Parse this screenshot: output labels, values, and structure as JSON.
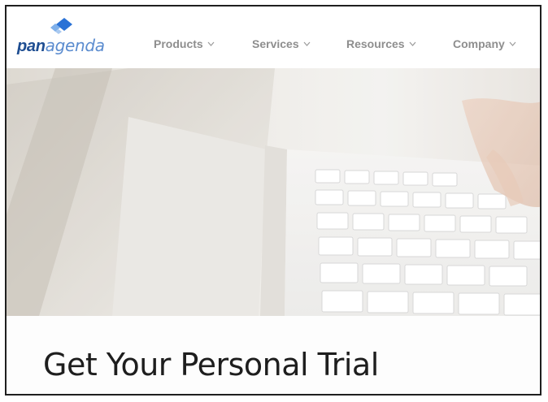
{
  "brand": {
    "logo_part1": "pan",
    "logo_part2": "agenda",
    "primary_color": "#1f4e92",
    "accent_color": "#5b8ccf"
  },
  "nav": {
    "items": [
      {
        "label": "Products",
        "icon": "chevron-down-icon"
      },
      {
        "label": "Services",
        "icon": "chevron-down-icon"
      },
      {
        "label": "Resources",
        "icon": "chevron-down-icon"
      },
      {
        "label": "Company",
        "icon": "chevron-down-icon"
      }
    ]
  },
  "hero": {
    "image": "laptop-keyboard-photo"
  },
  "page": {
    "heading": "Get Your Personal Trial"
  }
}
